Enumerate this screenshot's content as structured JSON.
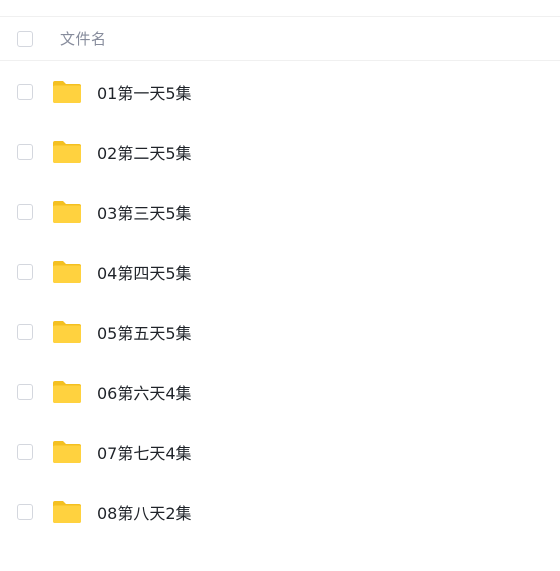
{
  "header": {
    "filename_label": "文件名"
  },
  "colors": {
    "folder": "#ffd23f",
    "folder_tab": "#f4c020",
    "checkbox_border": "#d4d7de",
    "divider": "#f0f0f0"
  },
  "files": [
    {
      "name": "01第一天5集",
      "icon": "folder-icon"
    },
    {
      "name": "02第二天5集",
      "icon": "folder-icon"
    },
    {
      "name": "03第三天5集",
      "icon": "folder-icon"
    },
    {
      "name": "04第四天5集",
      "icon": "folder-icon"
    },
    {
      "name": "05第五天5集",
      "icon": "folder-icon"
    },
    {
      "name": "06第六天4集",
      "icon": "folder-icon"
    },
    {
      "name": "07第七天4集",
      "icon": "folder-icon"
    },
    {
      "name": "08第八天2集",
      "icon": "folder-icon"
    }
  ]
}
